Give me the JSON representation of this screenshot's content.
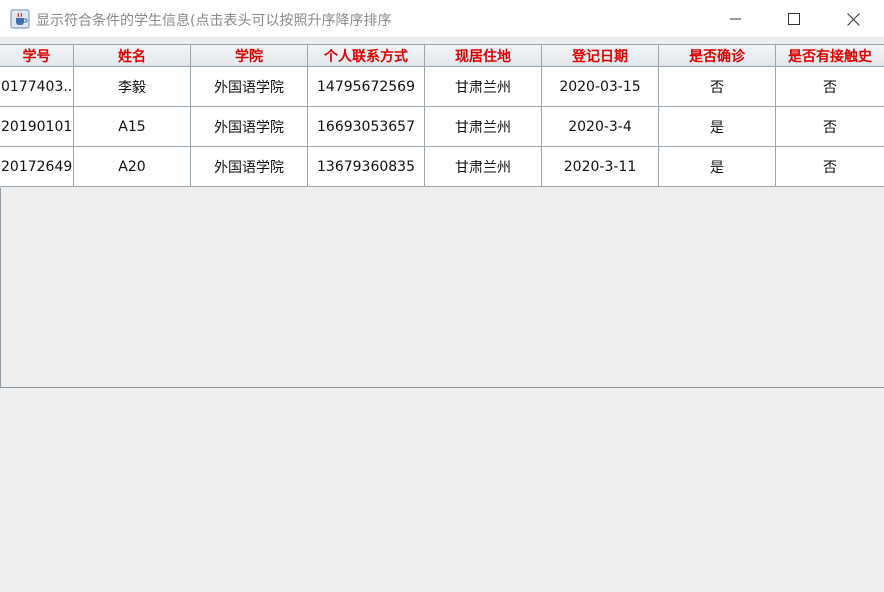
{
  "window": {
    "title": "显示符合条件的学生信息(点击表头可以按照升序降序排序",
    "app_icon": "java-cup-icon",
    "buttons": [
      "minimize-icon",
      "maximize-icon",
      "close-icon"
    ]
  },
  "table": {
    "headers": [
      "学号",
      "姓名",
      "学院",
      "个人联系方式",
      "现居住地",
      "登记日期",
      "是否确诊",
      "是否有接触史"
    ],
    "rows": [
      [
        "0177403...",
        "李毅",
        "外国语学院",
        "14795672569",
        "甘肃兰州",
        "2020-03-15",
        "否",
        "否"
      ],
      [
        "20190101",
        "A15",
        "外国语学院",
        "16693053657",
        "甘肃兰州",
        "2020-3-4",
        "是",
        "否"
      ],
      [
        "20172649",
        "A20",
        "外国语学院",
        "13679360835",
        "甘肃兰州",
        "2020-3-11",
        "是",
        "否"
      ]
    ]
  },
  "colors": {
    "header_text": "#e00000",
    "grid": "#9aa7b1",
    "panel_bg": "#eeeeee"
  }
}
